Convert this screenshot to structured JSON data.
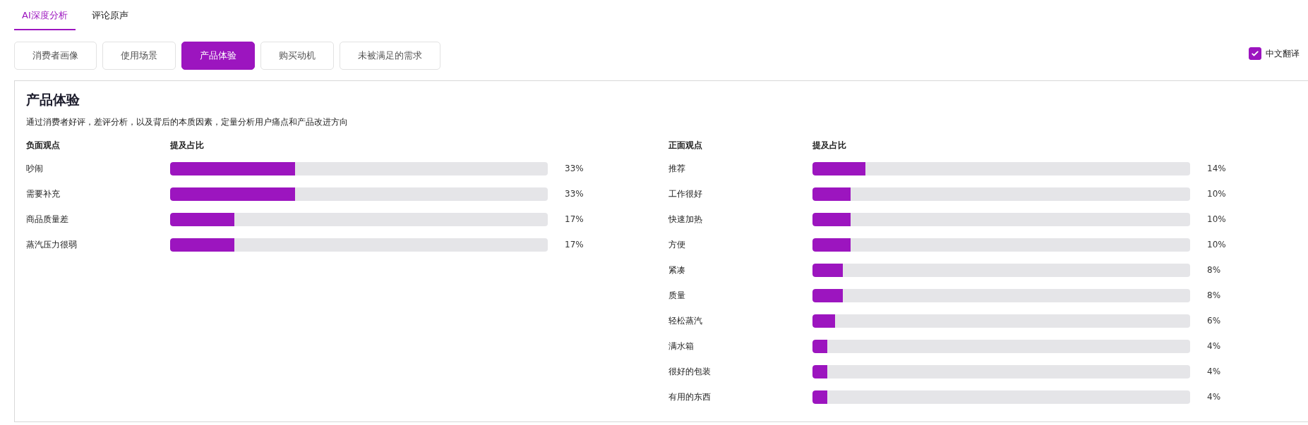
{
  "top_tabs": [
    {
      "label": "AI深度分析",
      "selected": true
    },
    {
      "label": "评论原声",
      "selected": false
    }
  ],
  "sub_tabs": [
    {
      "label": "消费者画像",
      "selected": false
    },
    {
      "label": "使用场景",
      "selected": false
    },
    {
      "label": "产品体验",
      "selected": true
    },
    {
      "label": "购买动机",
      "selected": false
    },
    {
      "label": "未被满足的需求",
      "selected": false
    }
  ],
  "translate": {
    "label": "中文翻译",
    "checked": true
  },
  "panel": {
    "title": "产品体验",
    "description": "通过消费者好评，差评分析，以及背后的本质因素，定量分析用户痛点和产品改进方向",
    "groups": [
      {
        "heading": "负面观点",
        "ratio_heading": "提及占比",
        "items": [
          {
            "label": "吵闹",
            "level": 0.33,
            "reading": "33%"
          },
          {
            "label": "需要补充",
            "level": 0.33,
            "reading": "33%"
          },
          {
            "label": "商品质量差",
            "level": 0.17,
            "reading": "17%"
          },
          {
            "label": "蒸汽压力很弱",
            "level": 0.17,
            "reading": "17%"
          }
        ]
      },
      {
        "heading": "正面观点",
        "ratio_heading": "提及占比",
        "items": [
          {
            "label": "推荐",
            "level": 0.14,
            "reading": "14%"
          },
          {
            "label": "工作很好",
            "level": 0.1,
            "reading": "10%"
          },
          {
            "label": "快速加热",
            "level": 0.1,
            "reading": "10%"
          },
          {
            "label": "方便",
            "level": 0.1,
            "reading": "10%"
          },
          {
            "label": "紧凑",
            "level": 0.08,
            "reading": "8%"
          },
          {
            "label": "质量",
            "level": 0.08,
            "reading": "8%"
          },
          {
            "label": "轻松蒸汽",
            "level": 0.06,
            "reading": "6%"
          },
          {
            "label": "满水箱",
            "level": 0.04,
            "reading": "4%"
          },
          {
            "label": "很好的包装",
            "level": 0.04,
            "reading": "4%"
          },
          {
            "label": "有用的东西",
            "level": 0.04,
            "reading": "4%"
          }
        ]
      }
    ]
  }
}
